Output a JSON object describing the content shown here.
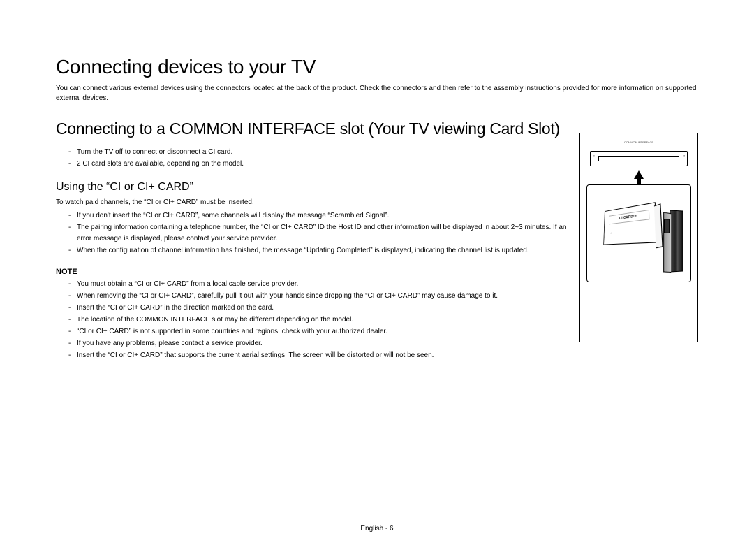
{
  "title": "Connecting devices to your TV",
  "intro": "You can connect various external devices using the connectors located at the back of the product. Check the connectors and then refer to the assembly instructions provided for more information on supported external devices.",
  "section2_title": "Connecting to a COMMON INTERFACE slot (Your TV viewing Card Slot)",
  "initial_notes": [
    "Turn the TV off to connect or disconnect a CI card.",
    "2 CI card slots are available, depending on the model."
  ],
  "section3_title": "Using the “CI or CI+ CARD”",
  "section3_intro": "To watch paid channels, the “CI or CI+ CARD” must be inserted.",
  "section3_bullets": [
    "If you don't insert the “CI or CI+ CARD”, some channels will display the message “Scrambled Signal”.",
    "The pairing information containing a telephone number, the “CI or CI+ CARD” ID the Host ID and other information will be displayed in about 2~3 minutes. If an error message is displayed, please contact your service provider.",
    "When the configuration of channel information has finished, the message “Updating Completed” is displayed, indicating the channel list is updated."
  ],
  "note_label": "NOTE",
  "note_bullets": [
    "You must obtain a “CI or CI+ CARD” from a local cable service provider.",
    "When removing the “CI or CI+ CARD”, carefully pull it out with your hands since dropping the “CI or CI+ CARD” may cause damage to it.",
    "Insert the “CI or CI+ CARD” in the direction marked on the card.",
    "The location of the COMMON INTERFACE slot may be different depending on the model.",
    "“CI or CI+ CARD” is not supported in some countries and regions; check with your authorized dealer.",
    "If you have any problems, please contact a service provider.",
    "Insert the “CI or CI+ CARD” that supports the current aerial settings. The screen will be distorted or will not be seen."
  ],
  "diagram": {
    "common_interface_label": "COMMON INTERFACE",
    "card_label": "CI CARDᵀᴹ"
  },
  "footer": "English - 6"
}
